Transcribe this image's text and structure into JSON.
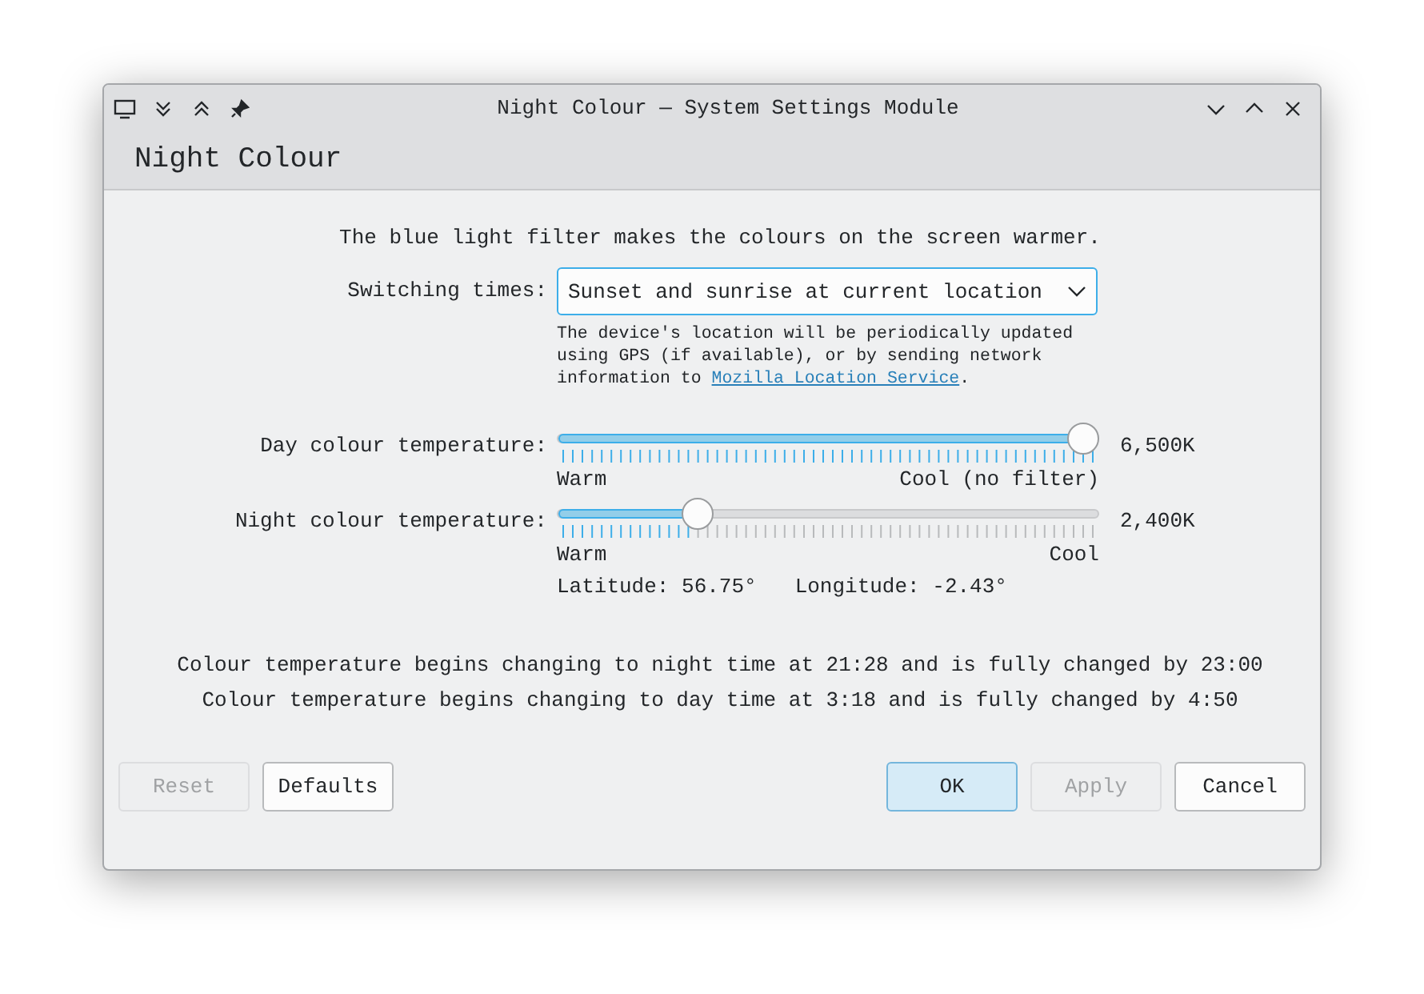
{
  "window": {
    "title": "Night Colour — System Settings Module"
  },
  "header": {
    "title": "Night Colour"
  },
  "intro": "The blue light filter makes the colours on the screen warmer.",
  "switching": {
    "label": "Switching times:",
    "value": "Sunset and sunrise at current location",
    "help": "The device's location will be periodically updated using GPS (if available), or by sending network information to",
    "link": "Mozilla Location Service",
    "help_end": "."
  },
  "sliders": [
    {
      "label": "Day colour temperature:",
      "level": 1.0,
      "reading": "6,500K",
      "min_label": "Warm",
      "max_label": "Cool (no filter)"
    },
    {
      "label": "Night colour temperature:",
      "level": 0.26,
      "reading": "2,400K",
      "min_label": "Warm",
      "max_label": "Cool"
    }
  ],
  "location": {
    "latitude": "Latitude: 56.75°",
    "longitude": "Longitude: -2.43°"
  },
  "schedule": [
    "Colour temperature begins changing to night time at 21:28 and is fully changed by 23:00",
    "Colour temperature begins changing to day time at 3:18 and is fully changed by 4:50"
  ],
  "buttons_left": [
    {
      "label": "Reset",
      "disabled": true,
      "highlighted": false
    },
    {
      "label": "Defaults",
      "disabled": false,
      "highlighted": false
    }
  ],
  "buttons_right": [
    {
      "label": "OK",
      "disabled": false,
      "highlighted": true
    },
    {
      "label": "Apply",
      "disabled": true,
      "highlighted": false
    },
    {
      "label": "Cancel",
      "disabled": false,
      "highlighted": false
    }
  ]
}
